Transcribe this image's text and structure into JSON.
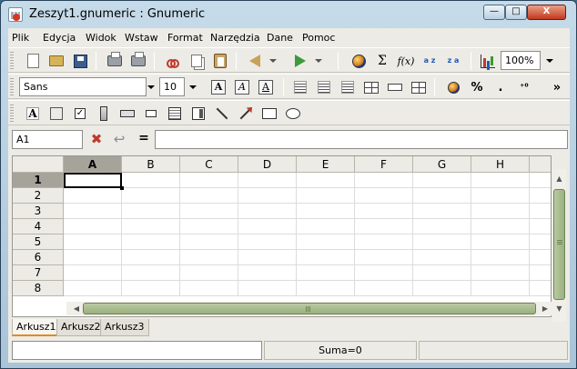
{
  "window": {
    "title": "Zeszyt1.gnumeric : Gnumeric",
    "min_label": "—",
    "max_label": "□",
    "close_label": "X"
  },
  "menu": [
    {
      "label": "Plik"
    },
    {
      "label": "Edycja"
    },
    {
      "label": "Widok"
    },
    {
      "label": "Wstaw"
    },
    {
      "label": "Format"
    },
    {
      "label": "Narzędzia"
    },
    {
      "label": "Dane"
    },
    {
      "label": "Pomoc"
    }
  ],
  "toolbar": {
    "zoom": "100%",
    "sigma": "Σ",
    "fx": "f(x)",
    "sort_az": "a z",
    "sort_za": "z a"
  },
  "format_toolbar": {
    "font_name": "Sans",
    "font_size": "10",
    "bold": "A",
    "italic": "A",
    "underline": "A",
    "percent": "%",
    "thousands": ".",
    "more": "»"
  },
  "formula_bar": {
    "cell_ref": "A1",
    "cancel": "✖",
    "accept": "↩",
    "equals": "=",
    "value": ""
  },
  "sheet": {
    "columns": [
      "A",
      "B",
      "C",
      "D",
      "E",
      "F",
      "G",
      "H"
    ],
    "rows": [
      "1",
      "2",
      "3",
      "4",
      "5",
      "6",
      "7",
      "8"
    ],
    "selected_col": "A",
    "selected_row": "1"
  },
  "tabs": [
    {
      "label": "Arkusz1",
      "active": true
    },
    {
      "label": "Arkusz2",
      "active": false
    },
    {
      "label": "Arkusz3",
      "active": false
    }
  ],
  "status": {
    "message": "",
    "sum": "Suma=0"
  }
}
